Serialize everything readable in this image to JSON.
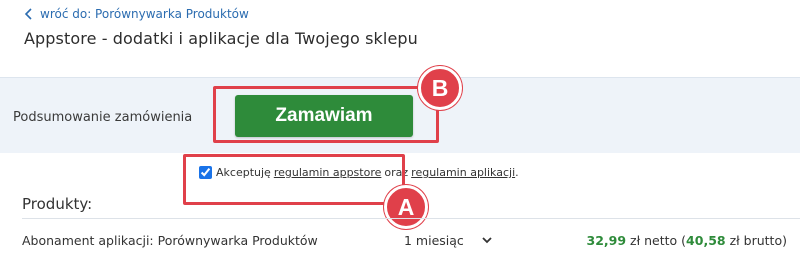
{
  "header": {
    "back_link": "wróć do: Porównywarka Produktów",
    "title": "Appstore - dodatki i aplikacje dla Twojego sklepu"
  },
  "summary": {
    "label": "Podsumowanie zamówienia",
    "order_button": "Zamawiam"
  },
  "terms": {
    "checked": true,
    "prefix": "Akceptuję",
    "link1": "regulamin appstore",
    "middle": "oraz",
    "link2": "regulamin aplikacji",
    "suffix": "."
  },
  "callouts": {
    "a": "A",
    "b": "B"
  },
  "products": {
    "heading": "Produkty:",
    "rows": [
      {
        "name": "Abonament aplikacji: Porównywarka Produktów",
        "period": "1 miesiąc",
        "net_amount": "32,99",
        "net_suffix": "zł netto (",
        "gross_amount": "40,58",
        "gross_suffix": "zł brutto)"
      }
    ]
  },
  "colors": {
    "accent_green": "#2e8b3a",
    "callout_red": "#e0404a",
    "link_blue": "#2b6cb0",
    "band_bg": "#eef3f9"
  },
  "icons": {
    "back": "chevron-left-icon",
    "dropdown": "chevron-down-icon"
  }
}
